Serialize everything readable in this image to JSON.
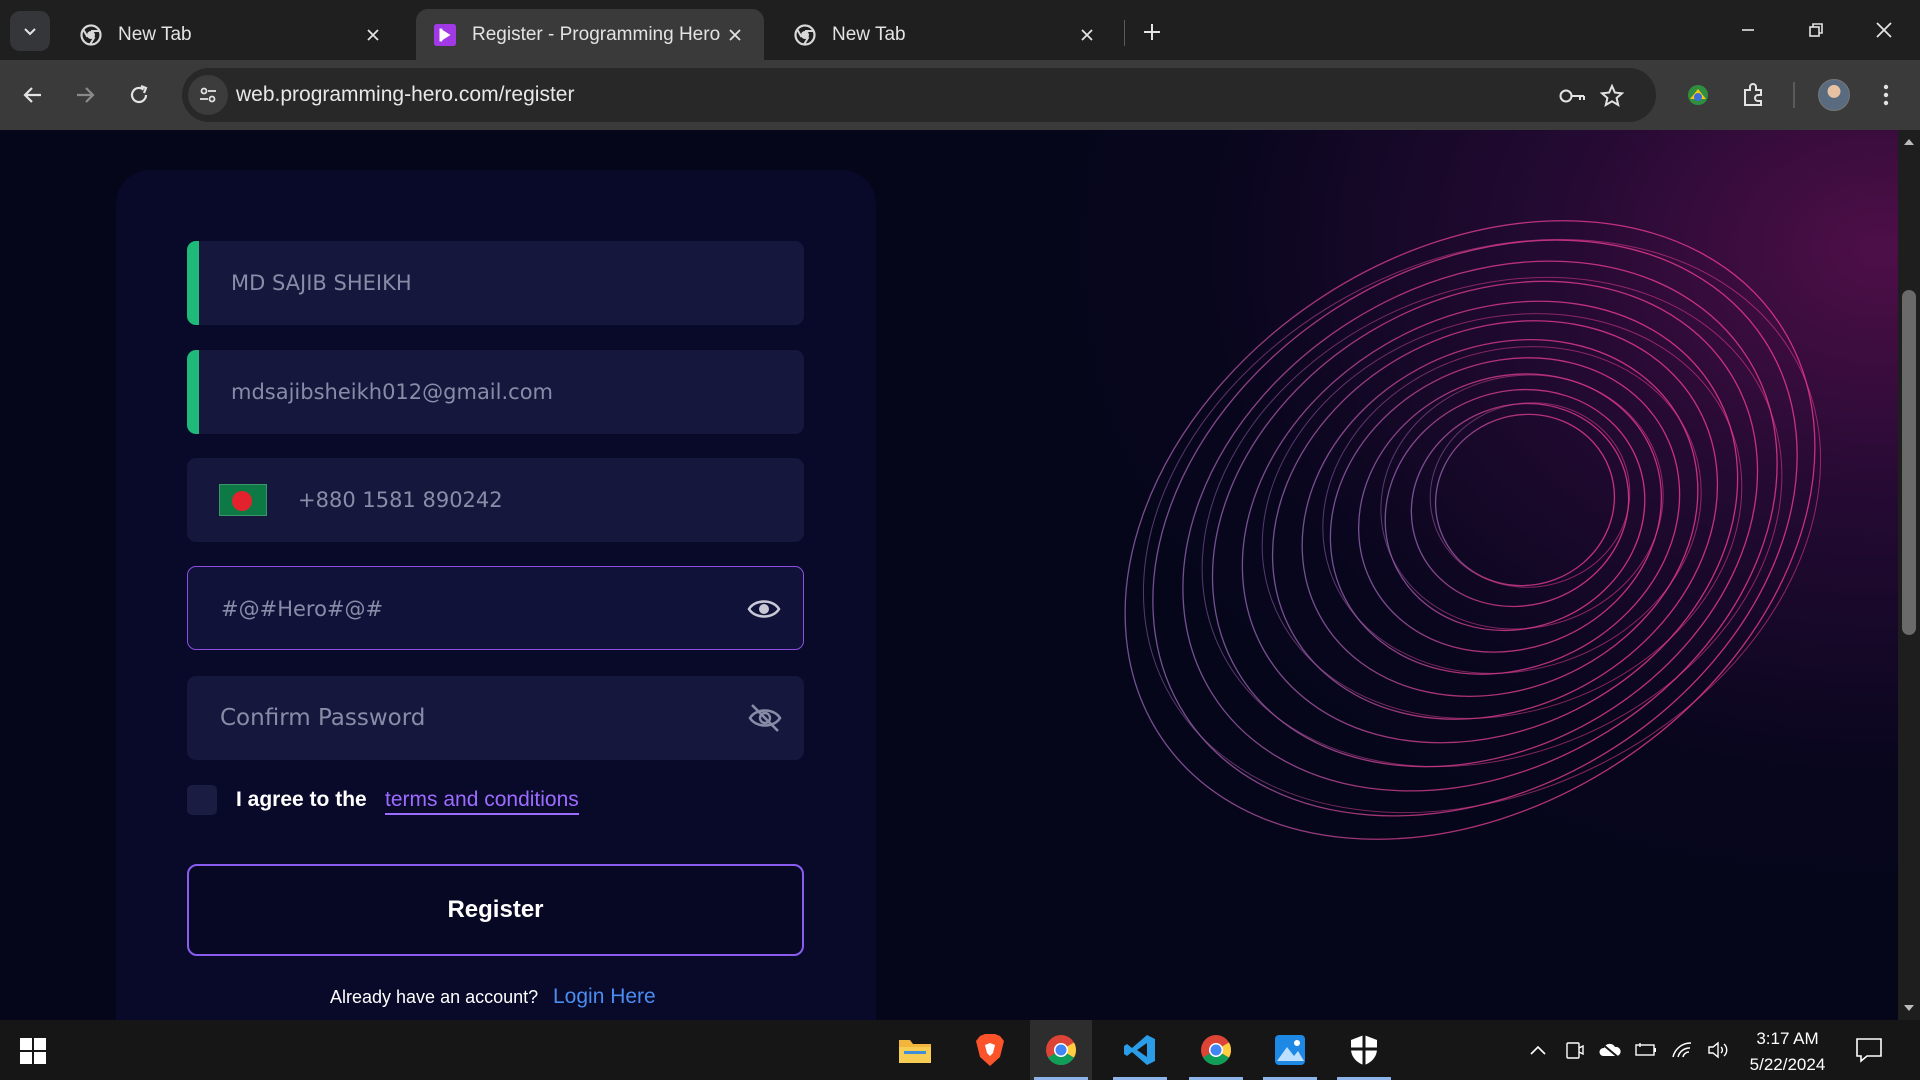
{
  "browser": {
    "tabs": [
      {
        "title": "New Tab",
        "active": false
      },
      {
        "title": "Register - Programming Hero",
        "active": true
      },
      {
        "title": "New Tab",
        "active": false
      }
    ],
    "url": "web.programming-hero.com/register"
  },
  "form": {
    "name_value": "MD SAJIB SHEIKH",
    "email_value": "mdsajibsheikh012@gmail.com",
    "phone_value": "+880 1581 890242",
    "password_value": "#@#Hero#@#",
    "confirm_password_placeholder": "Confirm Password",
    "agree_text": "I agree to the",
    "terms_link": "terms and conditions",
    "register_button": "Register",
    "already_text": "Already have an account?",
    "login_link": "Login Here"
  },
  "taskbar": {
    "time": "3:17 AM",
    "date": "5/22/2024"
  },
  "colors": {
    "accent_green": "#1fb979",
    "accent_purple": "#8a5cf0",
    "link_blue": "#4a8cf0",
    "card_bg": "#090a2a"
  }
}
